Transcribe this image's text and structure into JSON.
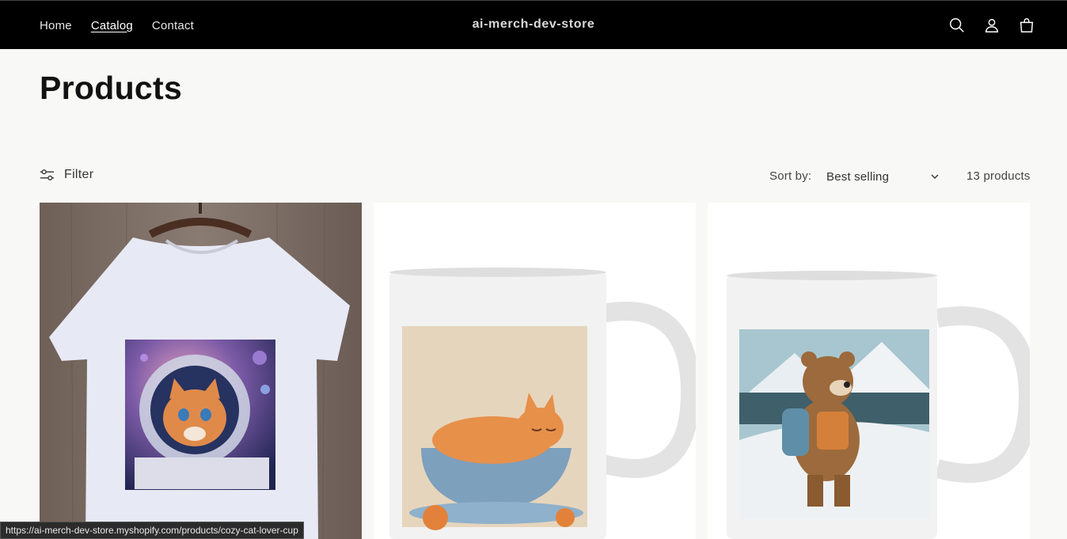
{
  "header": {
    "nav": [
      {
        "label": "Home"
      },
      {
        "label": "Catalog",
        "active": true
      },
      {
        "label": "Contact"
      }
    ],
    "store_name": "ai-merch-dev-store",
    "icons": [
      "search-icon",
      "account-icon",
      "cart-icon"
    ]
  },
  "page": {
    "title": "Products"
  },
  "toolbar": {
    "filter_label": "Filter",
    "sort_label": "Sort by:",
    "sort_value": "Best selling",
    "product_count": "13 products"
  },
  "products": [
    {
      "image": "astronaut cat t-shirt on hanger"
    },
    {
      "image": "sleeping cat in teacup mug"
    },
    {
      "image": "hiking bear mug"
    }
  ],
  "status_bar": {
    "url": "https://ai-merch-dev-store.myshopify.com/products/cozy-cat-lover-cup"
  },
  "colors": {
    "header_bg": "#000000",
    "page_bg": "#f8f8f6",
    "text": "#121212"
  }
}
